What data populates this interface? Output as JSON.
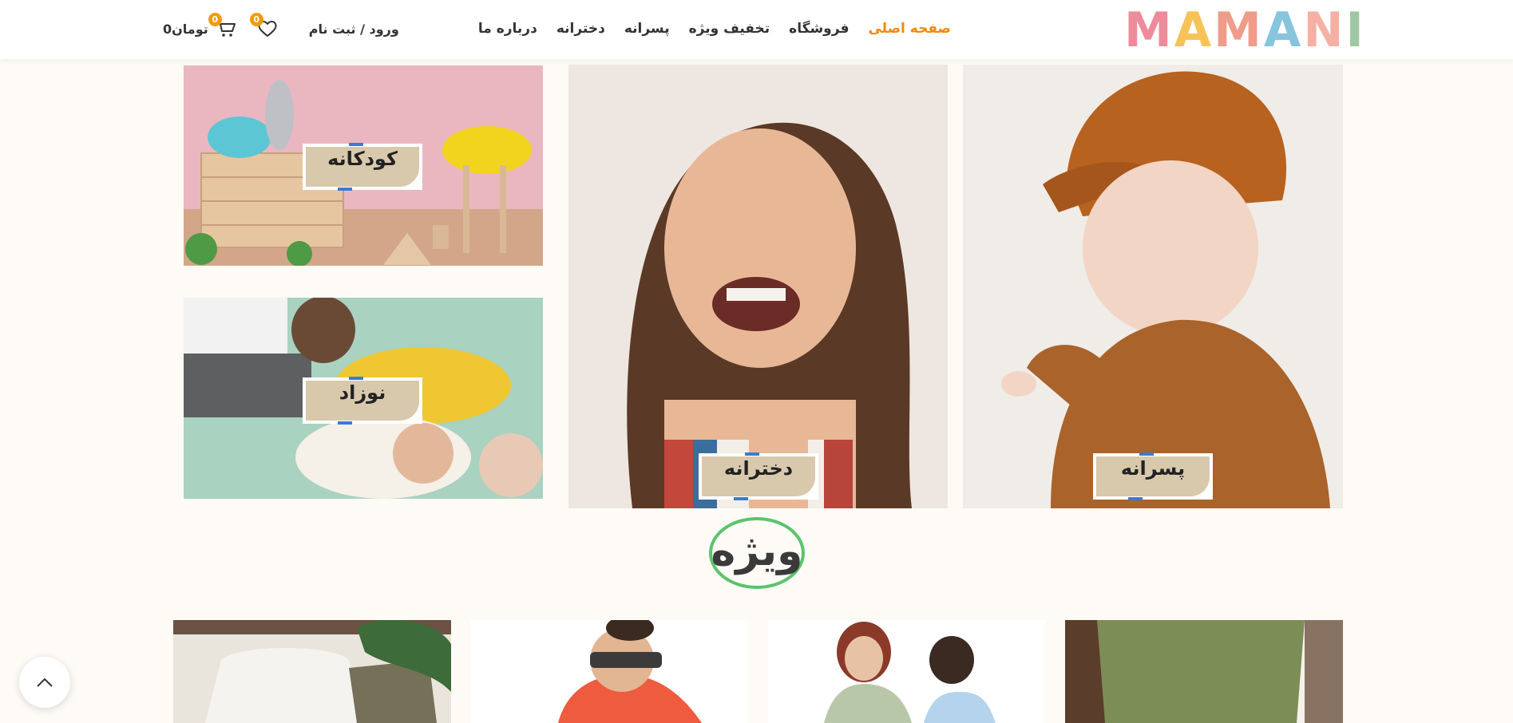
{
  "header": {
    "logo_letters": [
      "M",
      "A",
      "M",
      "A",
      "N",
      "I"
    ],
    "logo_colors": [
      "#ee8b9a",
      "#f7c357",
      "#ef9c8a",
      "#86c5dd",
      "#f4b1a3",
      "#9fc7a4"
    ],
    "nav": [
      {
        "label": "صفحه اصلی",
        "active": true
      },
      {
        "label": "فروشگاه"
      },
      {
        "label": "تخفیف ویژه"
      },
      {
        "label": "پسرانه"
      },
      {
        "label": "دخترانه"
      },
      {
        "label": "درباره ما"
      }
    ],
    "login_label": "ورود / ثبت نام",
    "wishlist_count": "0",
    "cart_count": "0",
    "cart_total": "تومان0",
    "accent": "#f0890a"
  },
  "categories": {
    "kids": "کودکانه",
    "newborn": "نوزاد",
    "girls": "دخترانه",
    "boys": "پسرانه"
  },
  "section_title": "ویژه",
  "colors": {
    "label_bg": "#d8c9ac",
    "special_ring": "#5cc36b",
    "page_bg": "#fefbf7"
  }
}
